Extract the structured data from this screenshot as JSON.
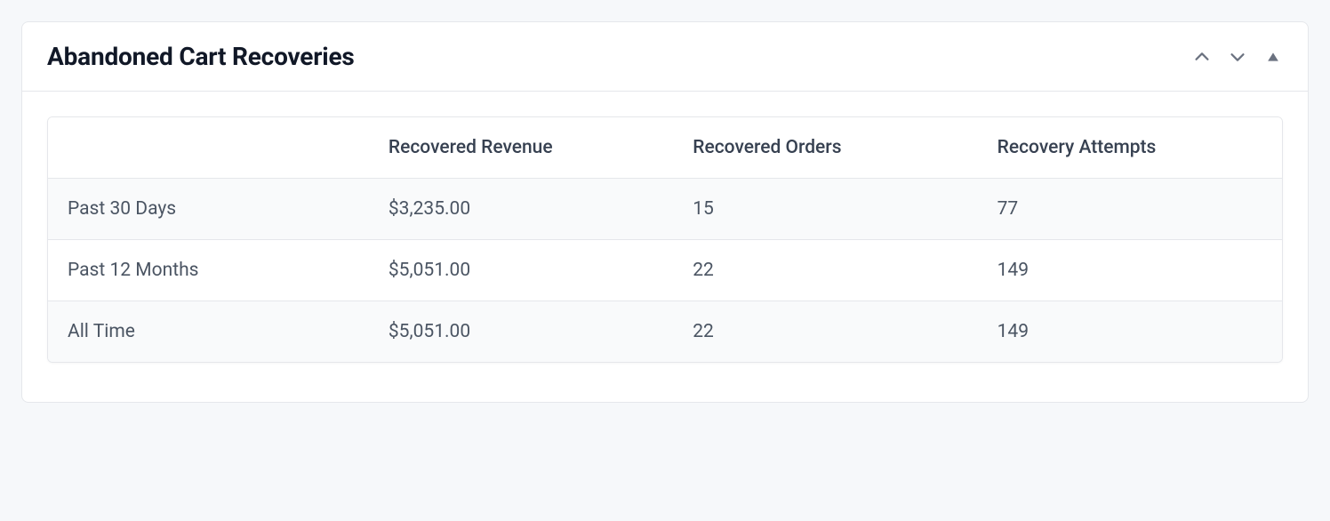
{
  "panel": {
    "title": "Abandoned Cart Recoveries"
  },
  "table": {
    "columns": {
      "revenue": "Recovered Revenue",
      "orders": "Recovered Orders",
      "attempts": "Recovery Attempts"
    },
    "rows": [
      {
        "period": "Past 30 Days",
        "revenue": "$3,235.00",
        "orders": "15",
        "attempts": "77"
      },
      {
        "period": "Past 12 Months",
        "revenue": "$5,051.00",
        "orders": "22",
        "attempts": "149"
      },
      {
        "period": "All Time",
        "revenue": "$5,051.00",
        "orders": "22",
        "attempts": "149"
      }
    ]
  }
}
